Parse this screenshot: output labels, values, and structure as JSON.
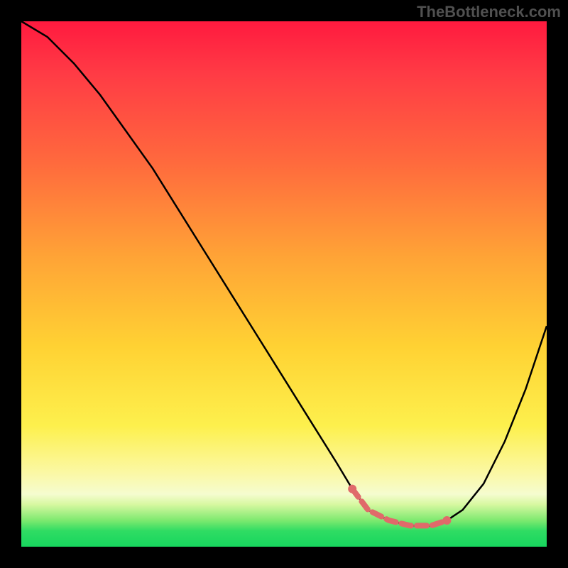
{
  "attribution": "TheBottleneck.com",
  "chart_data": {
    "type": "line",
    "title": "",
    "xlabel": "",
    "ylabel": "",
    "xlim": [
      0,
      100
    ],
    "ylim": [
      0,
      100
    ],
    "note": "Axes unlabeled; values are relative 0–100. Curve is a V-shape: steep descent from top-left to a flat minimum around x≈65–80, then rises toward the right edge. Short salmon segment marks the flat minimum region.",
    "series": [
      {
        "name": "bottleneck-curve",
        "color": "#000000",
        "x": [
          0,
          5,
          10,
          15,
          20,
          25,
          30,
          35,
          40,
          45,
          50,
          55,
          60,
          63,
          66,
          70,
          74,
          78,
          81,
          84,
          88,
          92,
          96,
          100
        ],
        "values": [
          100,
          97,
          92,
          86,
          79,
          72,
          64,
          56,
          48,
          40,
          32,
          24,
          16,
          11,
          7,
          5,
          4,
          4,
          5,
          7,
          12,
          20,
          30,
          42
        ]
      },
      {
        "name": "optimal-range-marker",
        "color": "#e06a6a",
        "x": [
          63,
          66,
          70,
          74,
          78,
          81
        ],
        "values": [
          11,
          7,
          5,
          4,
          4,
          5
        ]
      }
    ],
    "background_gradient": {
      "stops": [
        {
          "pos": 0,
          "color": "#ff1a3f"
        },
        {
          "pos": 45,
          "color": "#ffa436"
        },
        {
          "pos": 77,
          "color": "#fdf04d"
        },
        {
          "pos": 100,
          "color": "#17d65e"
        }
      ]
    }
  }
}
